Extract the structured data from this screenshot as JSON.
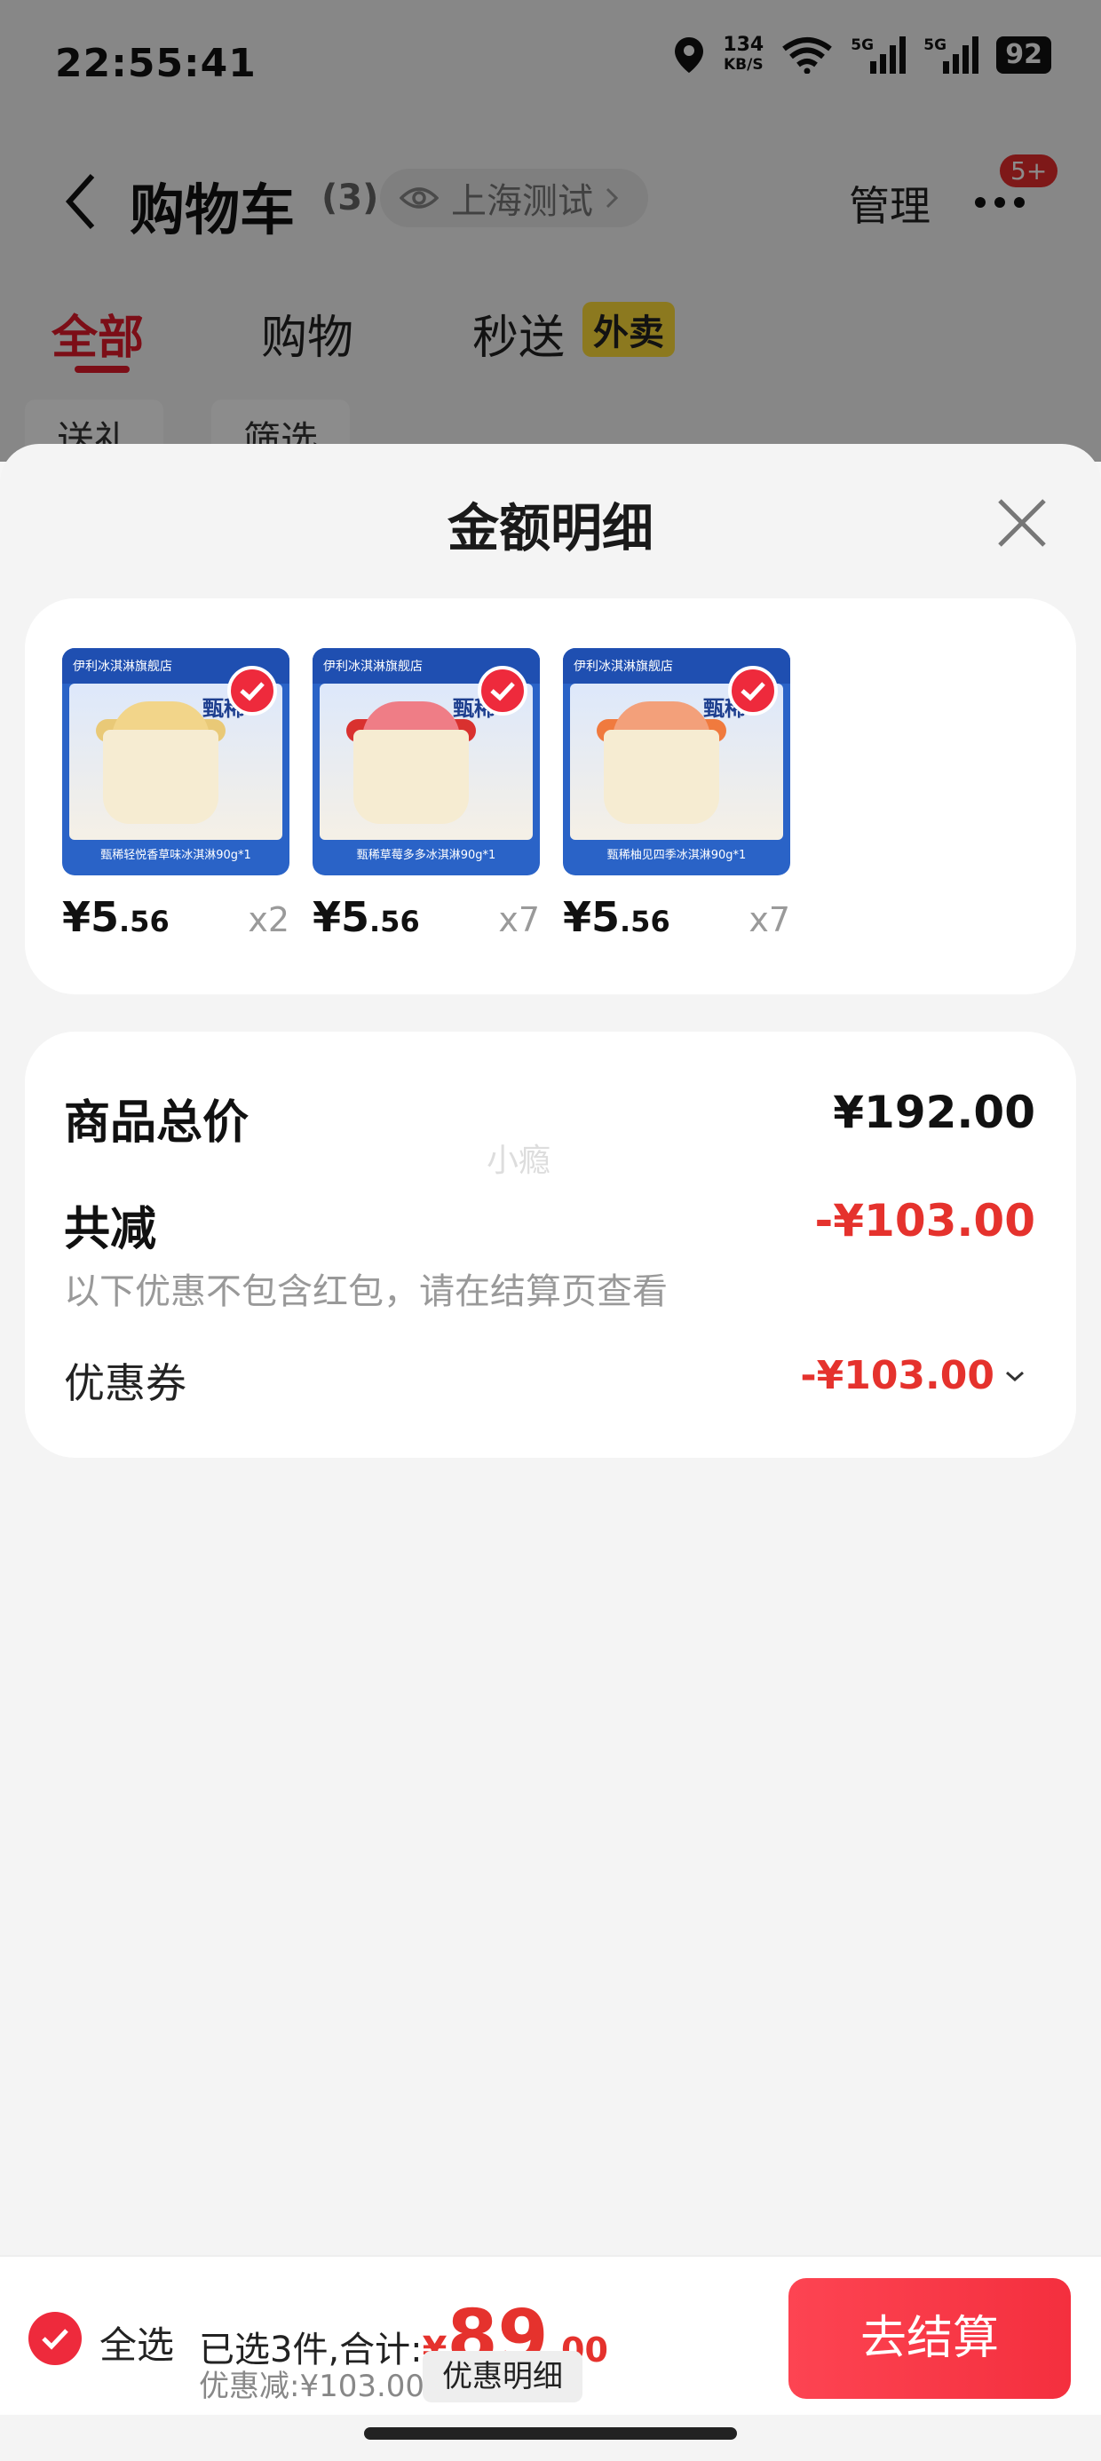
{
  "status_bar": {
    "time": "22:55:41",
    "net_speed_value": "134",
    "net_speed_unit": "KB/S",
    "signal_label_1": "5G",
    "signal_label_2": "5G",
    "battery": "92",
    "icons": [
      "location-icon",
      "wifi-icon",
      "signal-icon",
      "battery-icon"
    ]
  },
  "header": {
    "title": "购物车",
    "count": "(3)",
    "location": "上海测试",
    "manage": "管理",
    "badge": "5+"
  },
  "tabs": {
    "all": "全部",
    "shopping": "购物",
    "express": "秒送",
    "express_tag": "外卖"
  },
  "filters": {
    "gift": "送礼",
    "filter": "筛选"
  },
  "sheet": {
    "title": "金额明细",
    "products": [
      {
        "price_main": "¥5",
        "price_dec": ".56",
        "qty": "x2",
        "img_caption": "甄稀轻悦香草味冰淇淋90g*1"
      },
      {
        "price_main": "¥5",
        "price_dec": ".56",
        "qty": "x7",
        "img_caption": "甄稀草莓多多冰淇淋90g*1"
      },
      {
        "price_main": "¥5",
        "price_dec": ".56",
        "qty": "x7",
        "img_caption": "甄稀柚见四季冰淇淋90g*1"
      }
    ],
    "product_store": "伊利冰淇淋旗舰店",
    "product_brand": "甄稀",
    "summary": {
      "total_label": "商品总价",
      "total_value": "¥192.00",
      "reduce_label": "共减",
      "reduce_value": "-¥103.00",
      "note": "以下优惠不包含红包，请在结算页查看",
      "coupon_label": "优惠券",
      "coupon_value": "-¥103.00",
      "watermark": "小瘾"
    }
  },
  "checkout": {
    "select_all": "全选",
    "selected_text": "已选3件,合计:",
    "total_yen": "¥",
    "total_main": "89",
    "total_dec": ".00",
    "discount_text": "优惠减:¥103.00",
    "detail_button": "优惠明细",
    "checkout_button": "去结算"
  },
  "colors": {
    "accent_red": "#e5322d",
    "tab_red": "#e21b2a",
    "button_red": "#f42f3e",
    "tag_yellow": "#ffdc3a"
  }
}
